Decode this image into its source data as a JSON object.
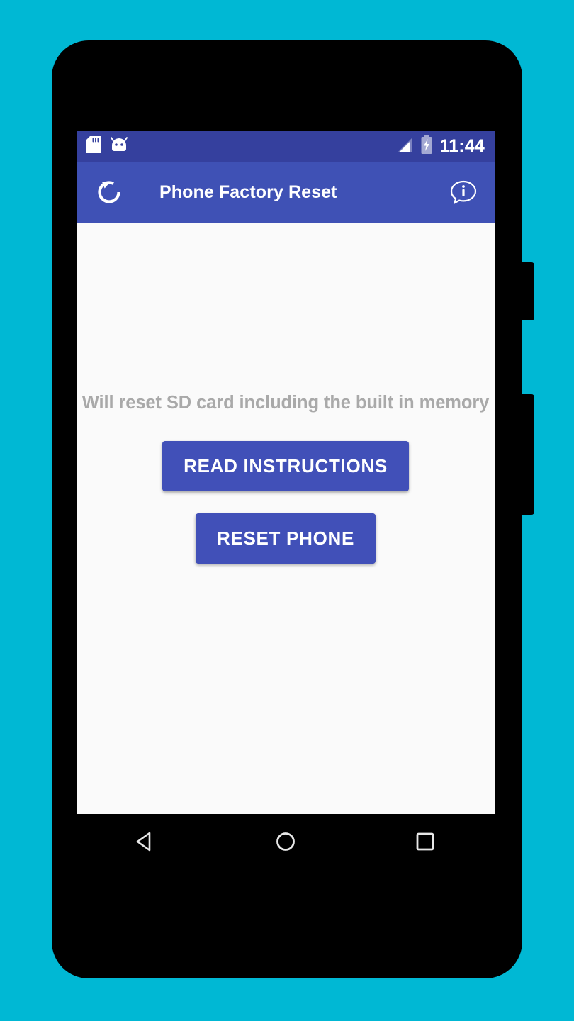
{
  "page": {
    "background_color": "#00b8d4",
    "device_body_color": "#000000"
  },
  "device": {
    "side_buttons": [
      {
        "name": "power-button"
      },
      {
        "name": "volume-button"
      }
    ]
  },
  "status_bar": {
    "background_color": "#35409e",
    "time": "11:44",
    "left_icons": [
      {
        "name": "sd-card-icon",
        "label": "SD card"
      },
      {
        "name": "android-head-icon",
        "label": "Android"
      }
    ],
    "right_icons": [
      {
        "name": "signal-bars-icon",
        "label": "Signal"
      },
      {
        "name": "battery-charging-icon",
        "label": "Battery charging"
      }
    ]
  },
  "app_bar": {
    "background_color": "#3f51b5",
    "title": "Phone Factory Reset",
    "left_icon": {
      "name": "refresh-reset-icon",
      "label": "Reset"
    },
    "right_icon": {
      "name": "info-bubble-icon",
      "label": "Info"
    }
  },
  "content": {
    "background_color": "#fafafa",
    "warning_text": "Will reset SD card including the built in memory",
    "warning_text_color": "#a9a9a9",
    "buttons": {
      "read_instructions_label": "READ INSTRUCTIONS",
      "reset_phone_label": "RESET PHONE",
      "button_color": "#4150b8"
    }
  },
  "nav_bar": {
    "background_color": "#000000",
    "buttons": [
      {
        "name": "back-button",
        "icon": "triangle-left-icon"
      },
      {
        "name": "home-button",
        "icon": "circle-icon"
      },
      {
        "name": "recents-button",
        "icon": "square-icon"
      }
    ]
  }
}
